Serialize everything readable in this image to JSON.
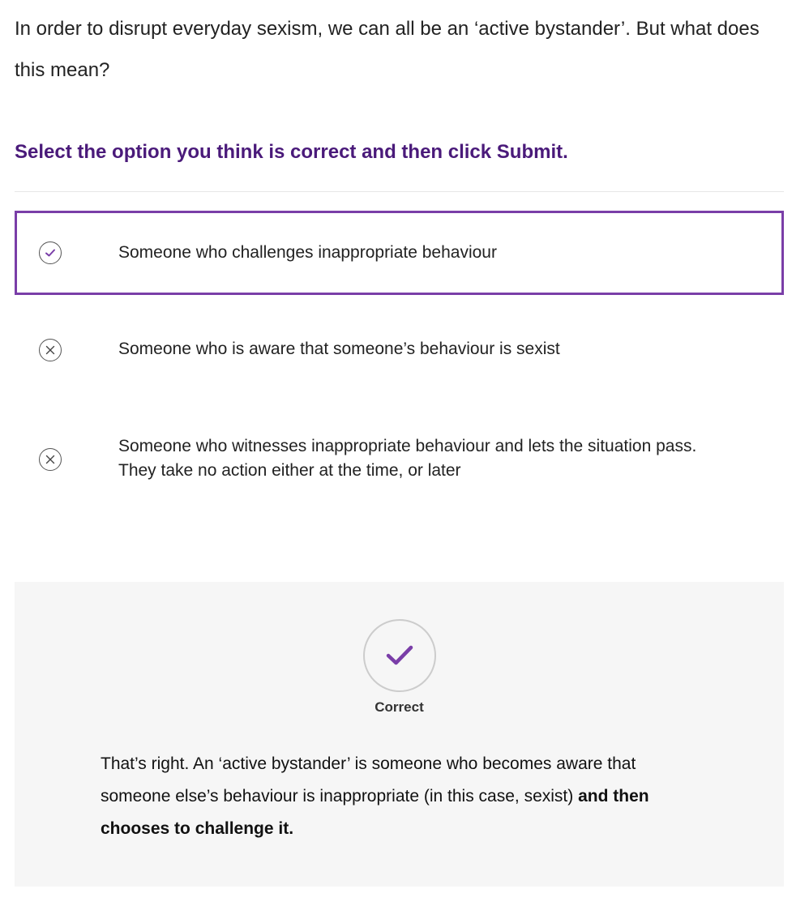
{
  "intro_text": "In order to disrupt everyday sexism, we can all be an ‘active bystander’. But what does this mean?",
  "instruction": "Select the option you think is correct and then click Submit.",
  "options": [
    {
      "label": "Someone who challenges inappropriate behaviour",
      "icon": "check-circle-icon",
      "selected": true
    },
    {
      "label": "Someone who is aware that someone’s behaviour is sexist",
      "icon": "x-circle-icon",
      "selected": false
    },
    {
      "label": "Someone who witnesses inappropriate behaviour and lets the situation pass. They take no action either at the time, or later",
      "icon": "x-circle-icon",
      "selected": false
    }
  ],
  "feedback": {
    "status": "Correct",
    "icon": "check-icon",
    "text": "That’s right. An ‘active bystander’ is someone who becomes aware that someone else’s behaviour is inappropriate (in this case, sexist) ",
    "text_bold": "and then chooses to challenge it."
  },
  "colors": {
    "accent": "#7a3ea8",
    "instruction": "#4a1a7a",
    "feedback_bg": "#f6f6f6"
  }
}
